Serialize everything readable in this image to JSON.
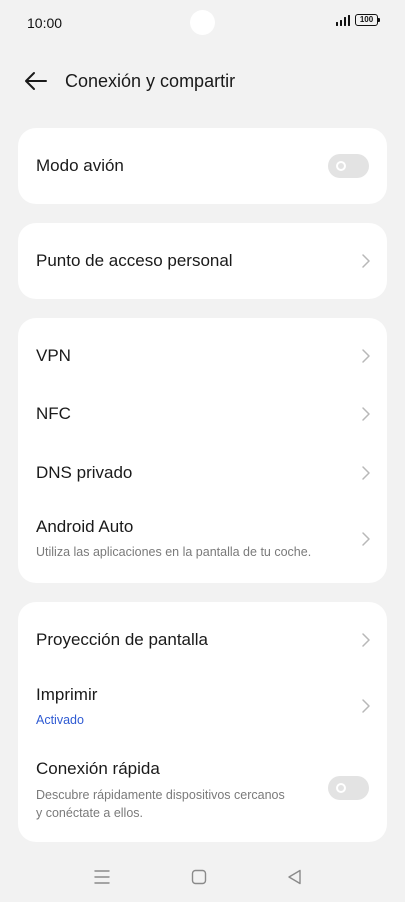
{
  "status_bar": {
    "time": "10:00",
    "battery": "100"
  },
  "header": {
    "title": "Conexión y compartir"
  },
  "cards": [
    {
      "rows": [
        {
          "title": "Modo avión",
          "control": "toggle",
          "enabled": false
        }
      ]
    },
    {
      "rows": [
        {
          "title": "Punto de acceso personal",
          "control": "chevron"
        }
      ]
    },
    {
      "rows": [
        {
          "title": "VPN",
          "control": "chevron"
        },
        {
          "title": "NFC",
          "control": "chevron"
        },
        {
          "title": "DNS privado",
          "control": "chevron"
        },
        {
          "title": "Android Auto",
          "subtitle": "Utiliza las aplicaciones en la pantalla de tu coche.",
          "control": "chevron"
        }
      ]
    },
    {
      "rows": [
        {
          "title": "Proyección de pantalla",
          "control": "chevron"
        },
        {
          "title": "Imprimir",
          "subtitle": "Activado",
          "control": "chevron"
        },
        {
          "title": "Conexión rápida",
          "subtitle_line1": "Descubre rápidamente dispositivos cercanos",
          "subtitle_line2": "y conéctate a ellos.",
          "control": "toggle",
          "enabled": false
        }
      ]
    }
  ],
  "nav_bar": {
    "buttons": [
      "menu-icon",
      "home-icon",
      "back-triangle-icon"
    ]
  },
  "colors": {
    "background": "#f2f2f2",
    "card": "#ffffff",
    "accent": "#2f5bd3",
    "toggle_off": "#e3e3e3"
  }
}
